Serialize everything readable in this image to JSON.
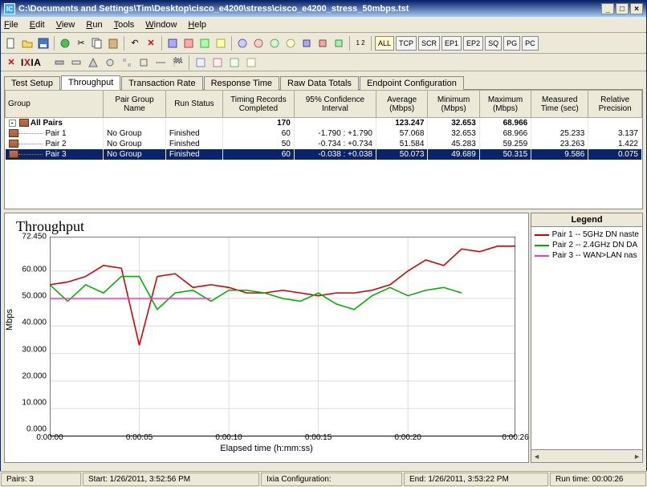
{
  "window": {
    "title": "C:\\Documents and Settings\\Tim\\Desktop\\cisco_e4200\\stress\\cisco_e4200_stress_50mbps.tst",
    "app_icon_text": "IC"
  },
  "menu": {
    "items": [
      "File",
      "Edit",
      "View",
      "Run",
      "Tools",
      "Window",
      "Help"
    ]
  },
  "toolbar_right": {
    "all": "ALL",
    "tcp": "TCP",
    "scr": "SCR",
    "ep1": "EP1",
    "ep2": "EP2",
    "sq": "SQ",
    "pg": "PG",
    "pc": "PC"
  },
  "brand": {
    "name_pre": "I",
    "name_x": "X",
    "name_post": "IA"
  },
  "tabs": [
    "Test Setup",
    "Throughput",
    "Transaction Rate",
    "Response Time",
    "Raw Data Totals",
    "Endpoint Configuration"
  ],
  "active_tab": 1,
  "grid": {
    "headers": [
      "Group",
      "Pair Group Name",
      "Run Status",
      "Timing Records Completed",
      "95% Confidence Interval",
      "Average (Mbps)",
      "Minimum (Mbps)",
      "Maximum (Mbps)",
      "Measured Time (sec)",
      "Relative Precision"
    ],
    "allrow": {
      "name": "All Pairs",
      "timing": "170",
      "avg": "123.247",
      "min": "32.653",
      "max": "68.966"
    },
    "rows": [
      {
        "pair": "Pair 1",
        "group": "No Group",
        "status": "Finished",
        "timing": "60",
        "ci": "-1.790 : +1.790",
        "avg": "57.068",
        "min": "32.653",
        "max": "68.966",
        "mt": "25.233",
        "rp": "3.137"
      },
      {
        "pair": "Pair 2",
        "group": "No Group",
        "status": "Finished",
        "timing": "50",
        "ci": "-0.734 : +0.734",
        "avg": "51.584",
        "min": "45.283",
        "max": "59.259",
        "mt": "23.263",
        "rp": "1.422"
      },
      {
        "pair": "Pair 3",
        "group": "No Group",
        "status": "Finished",
        "timing": "60",
        "ci": "-0.038 : +0.038",
        "avg": "50.073",
        "min": "49.689",
        "max": "50.315",
        "mt": "9.586",
        "rp": "0.075"
      }
    ],
    "selected": 2
  },
  "chart_data": {
    "type": "line",
    "title": "Throughput",
    "xlabel": "Elapsed time (h:mm:ss)",
    "ylabel": "Mbps",
    "ylim": [
      0,
      72.45
    ],
    "yticks": [
      0,
      10,
      20,
      30,
      40,
      50,
      60,
      72.45
    ],
    "ytick_labels": [
      "0.000",
      "10.000",
      "20.000",
      "30.000",
      "40.000",
      "50.000",
      "60.000",
      "72.450"
    ],
    "x": [
      0,
      1,
      2,
      3,
      4,
      5,
      6,
      7,
      8,
      9,
      10,
      11,
      12,
      13,
      14,
      15,
      16,
      17,
      18,
      19,
      20,
      21,
      22,
      23,
      24,
      25,
      26
    ],
    "xtick_positions": [
      0,
      5,
      10,
      15,
      20,
      26
    ],
    "xtick_labels": [
      "0:00:00",
      "0:00:05",
      "0:00:10",
      "0:00:15",
      "0:00:20",
      "0:00:26"
    ],
    "series": [
      {
        "name": "Pair 1 -- 5GHz DN naste",
        "color": "#d00000",
        "values": [
          55,
          56,
          58,
          62,
          61,
          33,
          58,
          59,
          54,
          55,
          54,
          52,
          52,
          53,
          52,
          51,
          52,
          52,
          53,
          55,
          60,
          64,
          62,
          68,
          67,
          69,
          69
        ]
      },
      {
        "name": "Pair 2 -- 2.4GHz DN DA",
        "color": "#00b000",
        "values": [
          55,
          49,
          55,
          52,
          58,
          58,
          46,
          52,
          53,
          49,
          53,
          53,
          52,
          50,
          49,
          52,
          48,
          46,
          51,
          54,
          51,
          53,
          54,
          52,
          null,
          null,
          null
        ]
      },
      {
        "name": "Pair 3 -- WAN>LAN nas",
        "color": "#ff33cc",
        "values": [
          50,
          50,
          50,
          50,
          50,
          50,
          50,
          50,
          50,
          50,
          null,
          null,
          null,
          null,
          null,
          null,
          null,
          null,
          null,
          null,
          null,
          null,
          null,
          null,
          null,
          null,
          null
        ]
      }
    ],
    "legend_title": "Legend"
  },
  "status": {
    "pairs": "Pairs: 3",
    "start": "Start: 1/26/2011, 3:52:56 PM",
    "config": "Ixia Configuration:",
    "end": "End: 1/26/2011, 3:53:22 PM",
    "runtime": "Run time: 00:00:26"
  }
}
